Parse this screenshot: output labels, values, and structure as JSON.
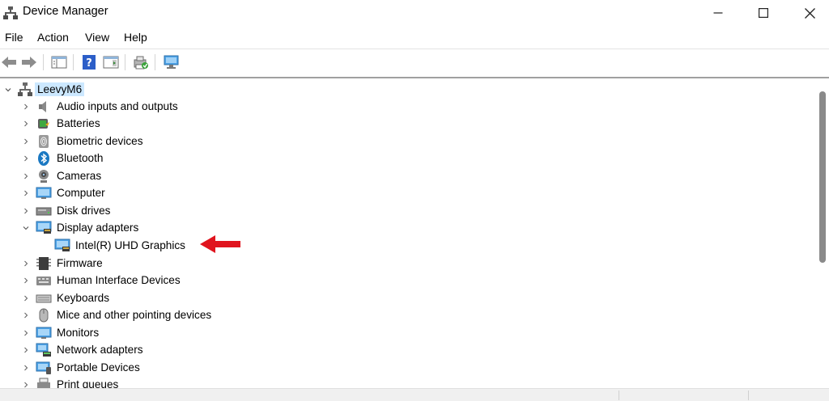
{
  "window": {
    "title": "Device Manager"
  },
  "menu": {
    "file": "File",
    "action": "Action",
    "view": "View",
    "help": "Help"
  },
  "toolbar": {
    "icons": [
      "back-arrow-icon",
      "forward-arrow-icon",
      "show-hide-console-tree-icon",
      "help-icon",
      "properties-pane-icon",
      "update-driver-icon",
      "scan-hardware-icon"
    ]
  },
  "tree": {
    "root": "LeevyM6",
    "categories": [
      {
        "label": "Audio inputs and outputs",
        "icon": "speaker-icon",
        "expanded": false
      },
      {
        "label": "Batteries",
        "icon": "battery-icon",
        "expanded": false
      },
      {
        "label": "Biometric devices",
        "icon": "fingerprint-icon",
        "expanded": false
      },
      {
        "label": "Bluetooth",
        "icon": "bluetooth-icon",
        "expanded": false
      },
      {
        "label": "Cameras",
        "icon": "camera-icon",
        "expanded": false
      },
      {
        "label": "Computer",
        "icon": "monitor-icon",
        "expanded": false
      },
      {
        "label": "Disk drives",
        "icon": "disk-drive-icon",
        "expanded": false
      },
      {
        "label": "Display adapters",
        "icon": "display-adapter-icon",
        "expanded": true,
        "children": [
          {
            "label": "Intel(R) UHD Graphics",
            "icon": "display-adapter-icon"
          }
        ]
      },
      {
        "label": "Firmware",
        "icon": "firmware-chip-icon",
        "expanded": false
      },
      {
        "label": "Human Interface Devices",
        "icon": "hid-icon",
        "expanded": false
      },
      {
        "label": "Keyboards",
        "icon": "keyboard-icon",
        "expanded": false
      },
      {
        "label": "Mice and other pointing devices",
        "icon": "mouse-icon",
        "expanded": false
      },
      {
        "label": "Monitors",
        "icon": "monitor-icon",
        "expanded": false
      },
      {
        "label": "Network adapters",
        "icon": "network-adapter-icon",
        "expanded": false
      },
      {
        "label": "Portable Devices",
        "icon": "portable-device-icon",
        "expanded": false
      },
      {
        "label": "Print queues",
        "icon": "printer-icon",
        "expanded": false
      }
    ]
  },
  "annotation": {
    "arrow_color": "#e0141e",
    "points_to": "Intel(R) UHD Graphics"
  },
  "colors": {
    "selection": "#cce8ff",
    "accent": "#1a78c2"
  }
}
